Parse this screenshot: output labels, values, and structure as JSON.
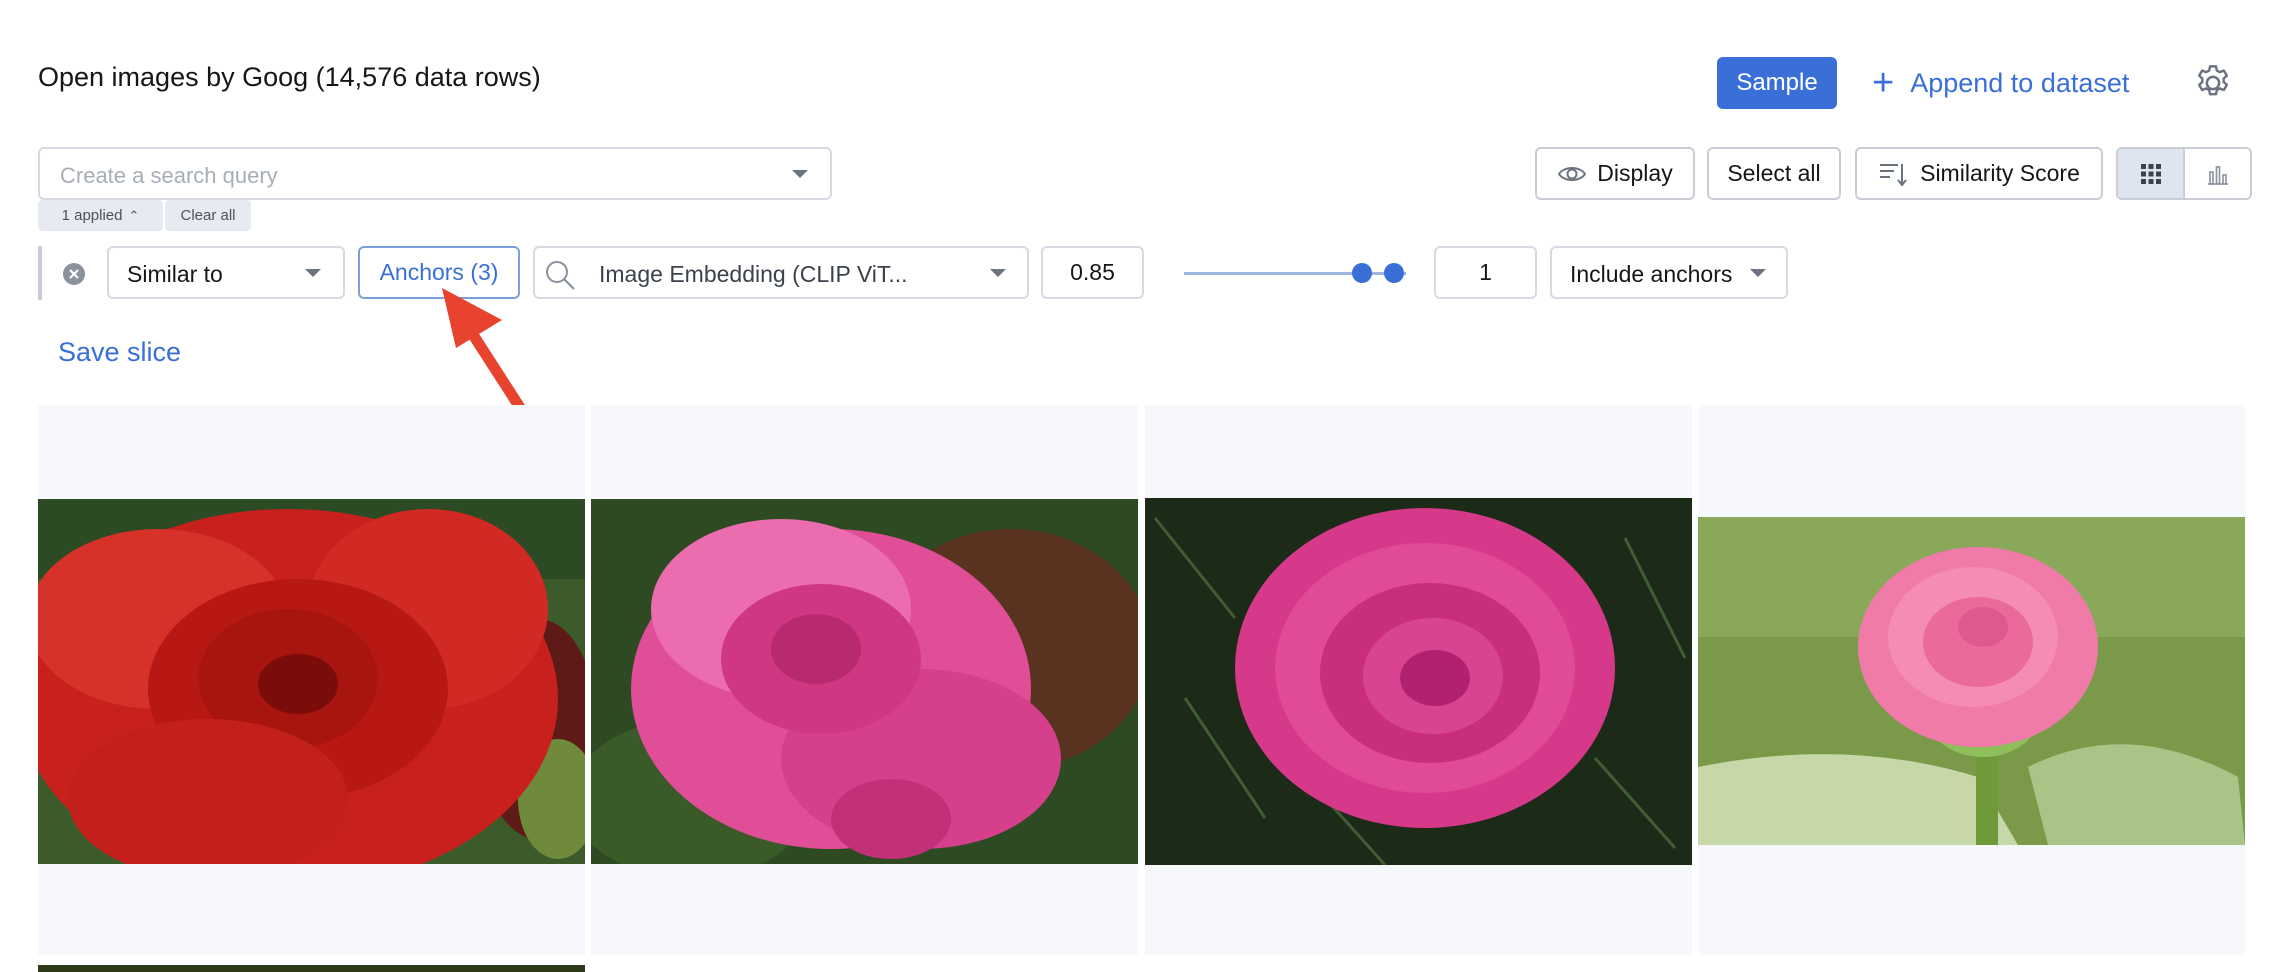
{
  "header": {
    "title": "Open images by Goog (14,576 data rows)",
    "sample_label": "Sample",
    "append_label": "Append to dataset",
    "settings_icon": "gear-icon"
  },
  "search": {
    "placeholder": "Create a search query"
  },
  "toolbar": {
    "display_label": "Display",
    "select_all_label": "Select all",
    "sort_label": "Similarity Score",
    "view_modes": [
      "grid",
      "chart"
    ],
    "active_view": "grid"
  },
  "filters_summary": {
    "applied_label": "1 applied",
    "clear_label": "Clear all"
  },
  "filter": {
    "operator": "Similar to",
    "anchors_label": "Anchors (3)",
    "embedding": "Image Embedding (CLIP ViT...",
    "threshold": "0.85",
    "slider_value": 0.85,
    "top_k": "1",
    "include_option": "Include anchors"
  },
  "save_slice_label": "Save slice",
  "colors": {
    "accent": "#3a6fd8",
    "annotation": "#e8432e"
  },
  "grid": {
    "items": [
      {
        "subject": "red rose"
      },
      {
        "subject": "pink rose"
      },
      {
        "subject": "pink rose"
      },
      {
        "subject": "pink rose"
      }
    ]
  }
}
